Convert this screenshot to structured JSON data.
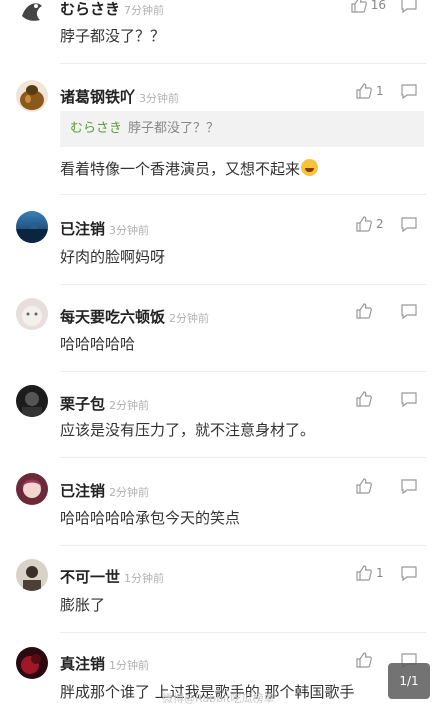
{
  "comments": [
    {
      "username": "むらさき",
      "time": "7分钟前",
      "likes": "16",
      "text": "脖子都没了？？"
    },
    {
      "username": "诸葛钢铁吖",
      "time": "3分钟前",
      "likes": "1",
      "quote": {
        "username": "むらさき",
        "text": "脖子都没了？？"
      },
      "text": "看着特像一个香港演员，又想不起来"
    },
    {
      "username": "已注销",
      "time": "3分钟前",
      "likes": "2",
      "text": "好肉的脸啊妈呀"
    },
    {
      "username": "每天要吃六顿饭",
      "time": "2分钟前",
      "likes": "",
      "text": "哈哈哈哈哈"
    },
    {
      "username": "栗子包",
      "time": "2分钟前",
      "likes": "",
      "text": "应该是没有压力了，就不注意身材了。"
    },
    {
      "username": "已注销",
      "time": "2分钟前",
      "likes": "",
      "text": "哈哈哈哈哈承包今天的笑点"
    },
    {
      "username": "不可一世",
      "time": "1分钟前",
      "likes": "1",
      "text": "膨胀了"
    },
    {
      "username": "真注销",
      "time": "1分钟前",
      "likes": "",
      "text": "胖成那个谁了  上过我是歌手的  那个韩国歌手"
    }
  ],
  "pager": "1/1",
  "watermark": "微博@Rabbit吃瓜榜单",
  "emoji": "laughing-tears-emoji",
  "icons": {
    "like": "thumbs-up-icon",
    "reply": "comment-bubble-icon"
  },
  "colors": {
    "quote_name": "#5a9a37",
    "time": "#b0b0b0"
  }
}
